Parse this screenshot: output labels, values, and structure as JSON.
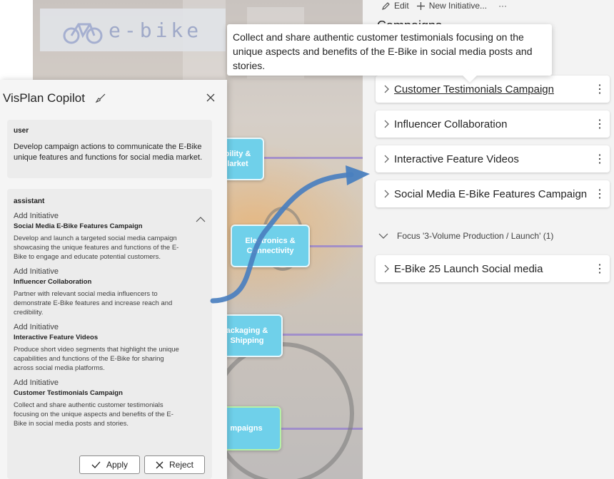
{
  "canvas": {
    "logo_text": "e-bike",
    "boxes": [
      "bility &\nlarket",
      "Electronics &\nConnectivity",
      "ackaging &\nShipping",
      "mpaigns"
    ]
  },
  "plan": {
    "toolbar": {
      "edit_label": "Edit",
      "new_initiative_label": "New Initiative...",
      "more": "···"
    },
    "heading_peek": "Campaigns",
    "cards": [
      {
        "label": "Customer Testimonials Campaign",
        "hovered": true
      },
      {
        "label": "Influencer Collaboration"
      },
      {
        "label": "Interactive Feature Videos"
      },
      {
        "label": "Social Media E-Bike Features Campaign"
      }
    ],
    "group_label": "Focus '3-Volume Production / Launch' (1)",
    "group_cards": [
      {
        "label": "E-Bike 25 Launch Social media"
      }
    ],
    "more_icon": "⋮"
  },
  "tooltip": {
    "text": "Collect and share authentic customer testimonials focusing on the unique aspects and benefits of the E-Bike in social media posts and stories."
  },
  "copilot": {
    "title": "VisPlan Copilot",
    "user": {
      "role": "user",
      "text": "Develop campaign actions to communicate the E-Bike unique features and functions for social media market."
    },
    "assistant": {
      "role": "assistant",
      "initiatives": [
        {
          "kind": "Add Initiative",
          "name": "Social Media E-Bike Features Campaign",
          "desc": "Develop and launch a targeted social media campaign showcasing the unique features and functions of the E-Bike to engage and educate potential customers."
        },
        {
          "kind": "Add Initiative",
          "name": "Influencer Collaboration",
          "desc": "Partner with relevant social media influencers to demonstrate E-Bike features and increase reach and credibility."
        },
        {
          "kind": "Add Initiative",
          "name": "Interactive Feature Videos",
          "desc": "Produce short video segments that highlight the unique capabilities and functions of the E-Bike for sharing across social media platforms."
        },
        {
          "kind": "Add Initiative",
          "name": "Customer Testimonials Campaign",
          "desc": "Collect and share authentic customer testimonials focusing on the unique aspects and benefits of the E-Bike in social media posts and stories."
        }
      ]
    },
    "apply_label": "Apply",
    "reject_label": "Reject"
  },
  "colors": {
    "accent_arrow": "#4a7fbf",
    "canvas_box": "#6fd0ea",
    "lane_line": "#9a86cc"
  }
}
